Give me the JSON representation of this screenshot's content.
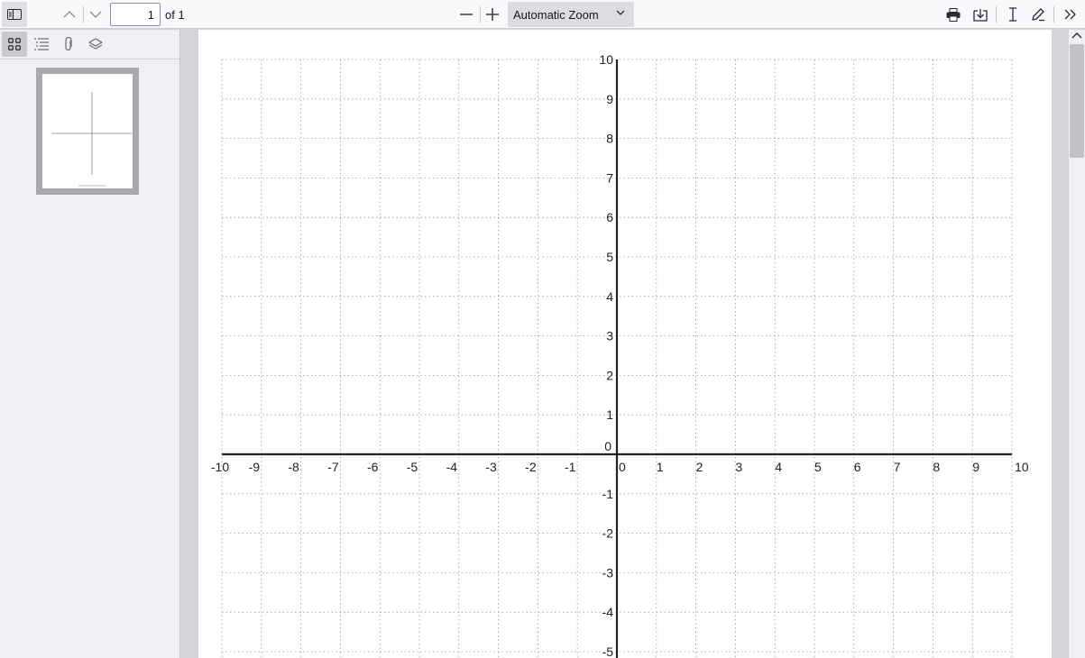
{
  "toolbar": {
    "page_number": "1",
    "page_of": "of 1",
    "zoom_label": "Automatic Zoom"
  },
  "icons": {
    "sidebar_toggle": "sidebar-toggle-icon",
    "previous_page": "chevron-up-icon",
    "next_page": "chevron-down-icon",
    "zoom_out": "minus-icon",
    "zoom_in": "plus-icon",
    "zoom_dropdown": "chevron-down-icon",
    "print": "printer-icon",
    "save": "download-icon",
    "text_tool": "text-cursor-icon",
    "draw_tool": "pencil-icon",
    "tools_menu": "double-chevron-right-icon",
    "thumbnails": "thumbnail-grid-icon",
    "outline": "outline-list-icon",
    "attachments": "paperclip-icon",
    "layers": "layers-icon"
  },
  "colors": {
    "toolbar_bg": "#f9f9fb",
    "sidebar_bg": "#f0f0f4",
    "viewer_bg": "#d4d4d8",
    "axis": "#222222",
    "grid": "#9a9a9a"
  },
  "chart_data": {
    "type": "scatter",
    "title": "",
    "xlabel": "",
    "ylabel": "",
    "xlim": [
      -10,
      10
    ],
    "ylim": [
      -10,
      10
    ],
    "x_ticks": [
      "-10",
      "-9",
      "-8",
      "-7",
      "-6",
      "-5",
      "-4",
      "-3",
      "-2",
      "-1",
      "0",
      "1",
      "2",
      "3",
      "4",
      "5",
      "6",
      "7",
      "8",
      "9",
      "10"
    ],
    "y_ticks": [
      "10",
      "9",
      "8",
      "7",
      "6",
      "5",
      "4",
      "3",
      "2",
      "1",
      "0",
      "-1",
      "-2",
      "-3",
      "-4",
      "-5"
    ],
    "grid": true,
    "series": []
  }
}
